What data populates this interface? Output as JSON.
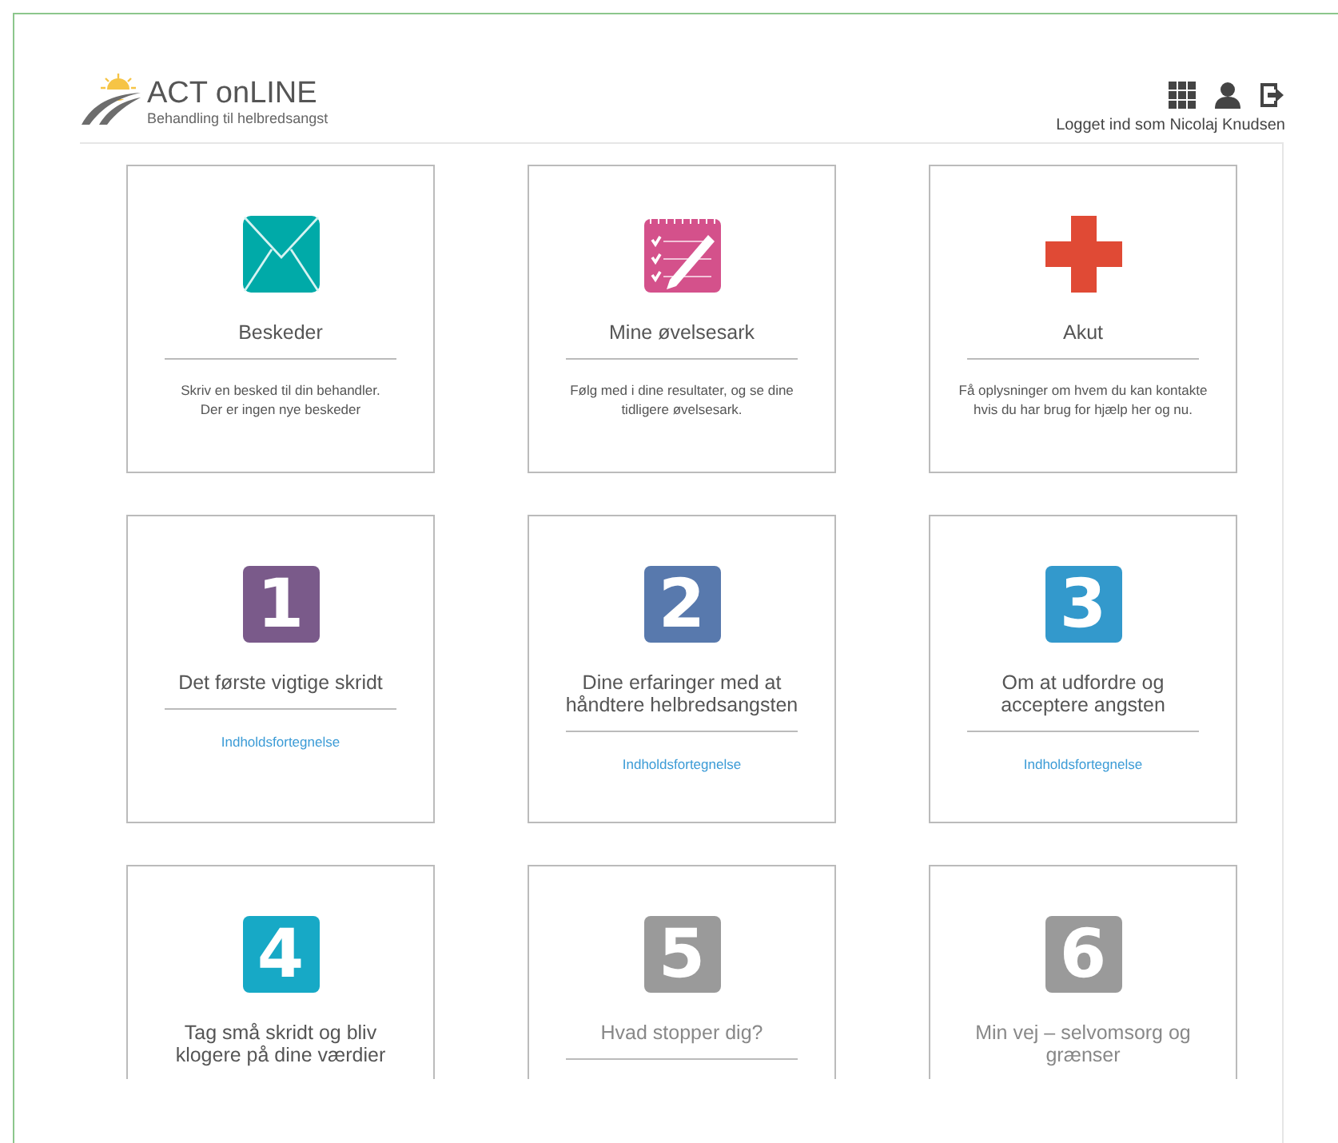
{
  "logo": {
    "name": "ACT onLINE",
    "tagline": "Behandling til helbredsangst"
  },
  "user": {
    "logged_in_text": "Logget ind som Nicolaj Knudsen"
  },
  "cards": [
    {
      "kind": "message",
      "title": "Beskeder",
      "description": "Skriv en besked til din behandler.\nDer er ingen nye beskeder"
    },
    {
      "kind": "worksheet",
      "title": "Mine øvelsesark",
      "description": "Følg med i dine resultater, og se dine\ntidligere øvelsesark."
    },
    {
      "kind": "emergency",
      "title": "Akut",
      "description": "Få oplysninger om hvem du kan kontakte\nhvis du har brug for hjælp her og nu."
    },
    {
      "kind": "chapter",
      "number": "1",
      "color": "#7a5a8a",
      "locked": false,
      "title": "Det første vigtige skridt",
      "link": "Indholdsfortegnelse"
    },
    {
      "kind": "chapter",
      "number": "2",
      "color": "#5879ad",
      "locked": false,
      "title": "Dine erfaringer med at\nhåndtere helbredsangsten",
      "link": "Indholdsfortegnelse"
    },
    {
      "kind": "chapter",
      "number": "3",
      "color": "#3399cc",
      "locked": false,
      "title": "Om at udfordre og\nacceptere angsten",
      "link": "Indholdsfortegnelse"
    },
    {
      "kind": "chapter",
      "number": "4",
      "color": "#17a9c6",
      "locked": false,
      "title": "Tag små skridt og bliv\nklogere på dine værdier"
    },
    {
      "kind": "chapter",
      "number": "5",
      "color": "#9a9a9a",
      "locked": true,
      "title": "Hvad stopper dig?"
    },
    {
      "kind": "chapter",
      "number": "6",
      "color": "#9a9a9a",
      "locked": true,
      "title": "Min vej – selvomsorg og\ngrænser"
    }
  ]
}
